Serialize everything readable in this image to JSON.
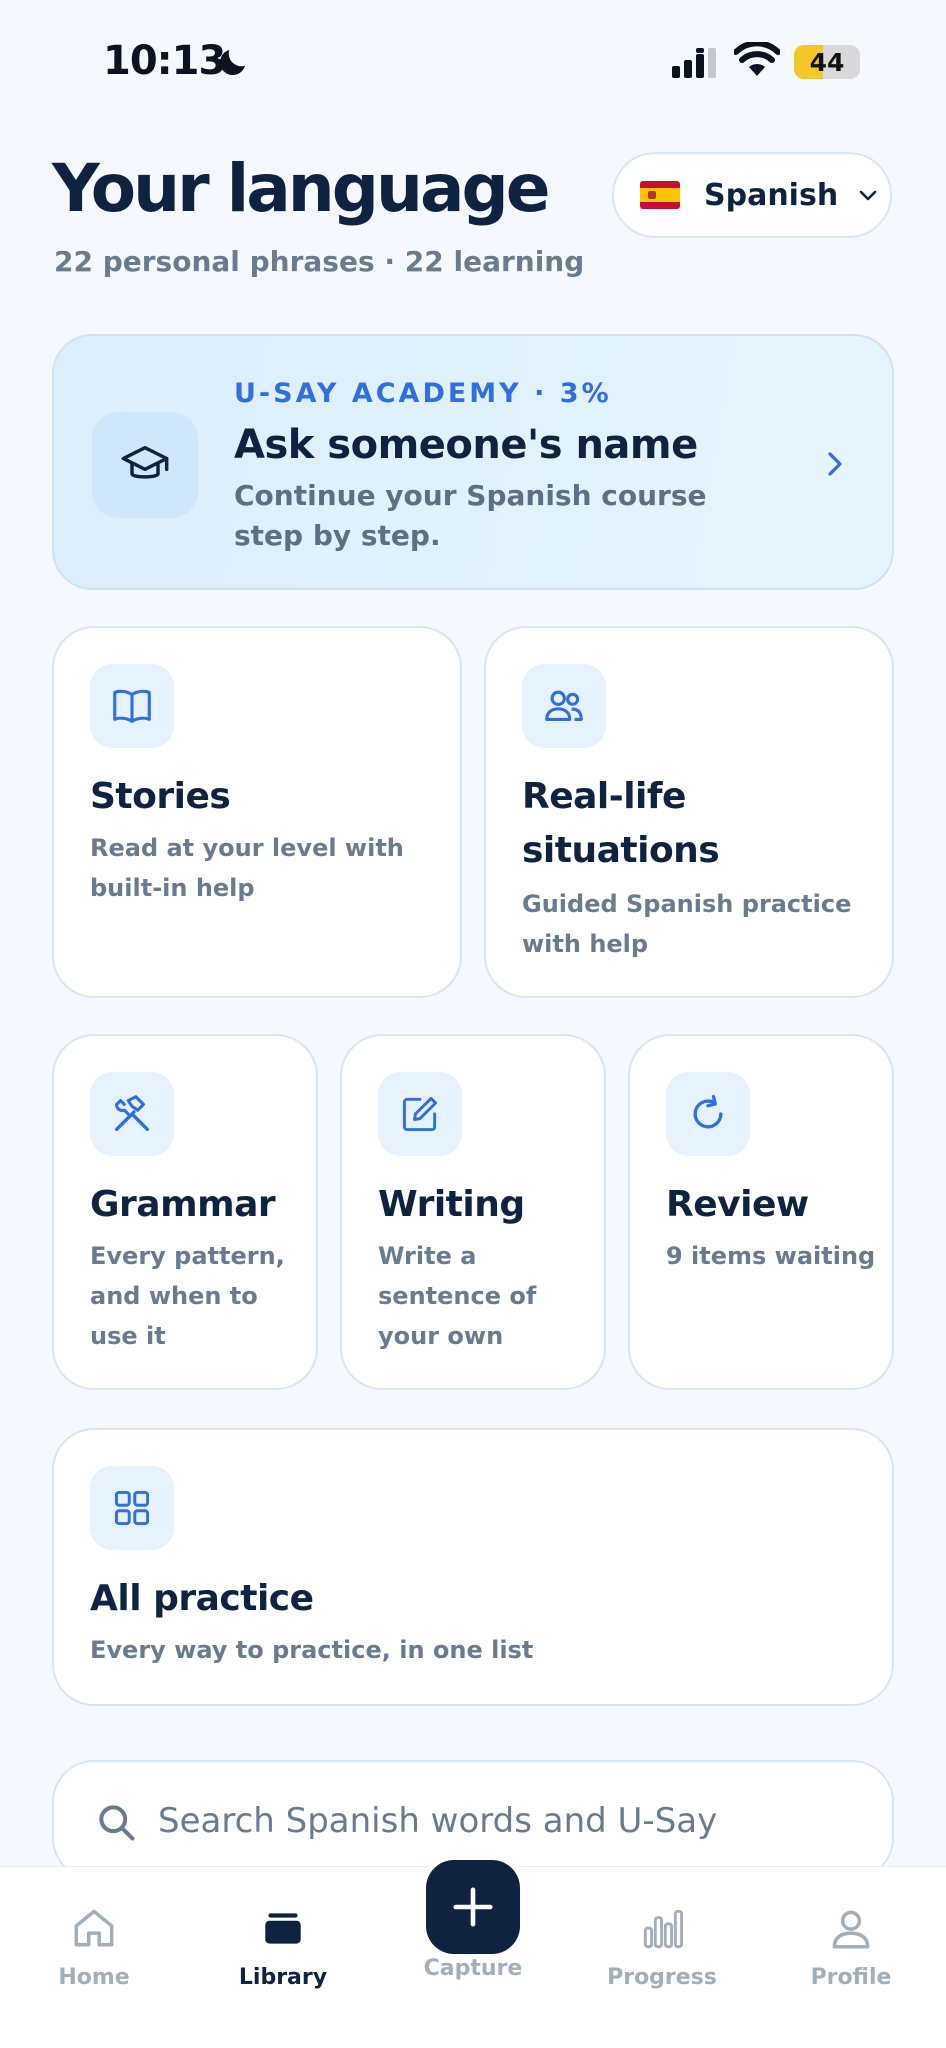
{
  "status_bar": {
    "time": "10:13",
    "battery": "44",
    "battery_level": 0.44
  },
  "header": {
    "title": "Your language",
    "subtitle": "22 personal phrases · 22 learning",
    "language": "Spanish"
  },
  "academy": {
    "kicker": "U-SAY ACADEMY · 3%",
    "title": "Ask someone's name",
    "description": "Continue your Spanish course step by step."
  },
  "cards": {
    "stories": {
      "title": "Stories",
      "description": "Read at your level with built-in help"
    },
    "real_life": {
      "title": "Real-life situations",
      "description": "Guided Spanish practice with help"
    },
    "grammar": {
      "title": "Grammar",
      "description": "Every pattern, and when to use it"
    },
    "writing": {
      "title": "Writing",
      "description": "Write a sentence of your own"
    },
    "review": {
      "title": "Review",
      "description": "9 items waiting"
    },
    "all_practice": {
      "title": "All practice",
      "description": "Every way to practice, in one list"
    }
  },
  "search": {
    "placeholder": "Search Spanish words and U-Say"
  },
  "tab_bar": {
    "home": "Home",
    "library": "Library",
    "capture": "Capture",
    "progress": "Progress",
    "profile": "Profile",
    "active_tab": "Library"
  },
  "colors": {
    "primary": "#0f2340",
    "accent": "#2f6fde",
    "muted": "#6b7b8e",
    "background": "#f5f9fd"
  },
  "icons": [
    "moon-icon",
    "signal-icon",
    "wifi-icon",
    "chevron-down-icon",
    "graduation-cap-icon",
    "chevron-right-icon",
    "book-icon",
    "people-icon",
    "tools-icon",
    "edit-icon",
    "refresh-icon",
    "grid-icon",
    "search-icon",
    "home-icon",
    "library-icon",
    "plus-icon",
    "bar-chart-icon",
    "user-icon"
  ]
}
